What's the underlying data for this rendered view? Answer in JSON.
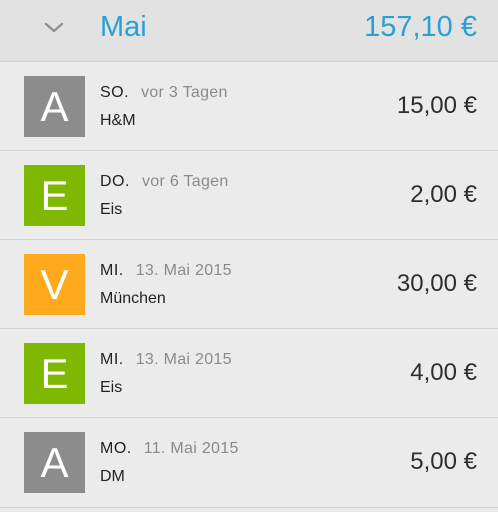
{
  "header": {
    "month": "Mai",
    "total": "157,10 €"
  },
  "entries": [
    {
      "initial": "A",
      "color": "#8c8c8c",
      "day": "SO.",
      "date": "vor 3 Tagen",
      "desc": "H&M",
      "amount": "15,00 €"
    },
    {
      "initial": "E",
      "color": "#7fb800",
      "day": "DO.",
      "date": "vor 6 Tagen",
      "desc": "Eis",
      "amount": "2,00 €"
    },
    {
      "initial": "V",
      "color": "#ffaa1c",
      "day": "MI.",
      "date": "13. Mai 2015",
      "desc": "München",
      "amount": "30,00 €"
    },
    {
      "initial": "E",
      "color": "#7fb800",
      "day": "MI.",
      "date": "13. Mai 2015",
      "desc": "Eis",
      "amount": "4,00 €"
    },
    {
      "initial": "A",
      "color": "#8c8c8c",
      "day": "MO.",
      "date": "11. Mai 2015",
      "desc": "DM",
      "amount": "5,00 €"
    }
  ]
}
